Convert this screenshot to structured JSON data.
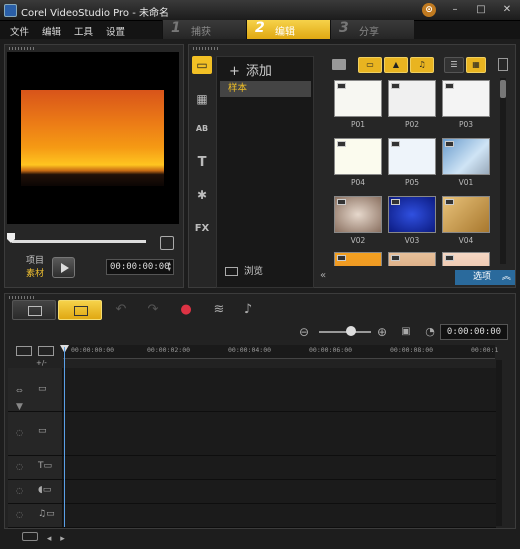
{
  "window": {
    "title": "Corel VideoStudio Pro - 未命名",
    "help_glyph": "⊙",
    "minimize_glyph": "–",
    "maximize_glyph": "□",
    "close_glyph": "✕"
  },
  "menu": [
    "文件",
    "编辑",
    "工具",
    "设置"
  ],
  "steps": [
    {
      "num": "1",
      "label": "捕获",
      "active": false
    },
    {
      "num": "2",
      "label": "编辑",
      "active": true
    },
    {
      "num": "3",
      "label": "分享",
      "active": false
    }
  ],
  "player": {
    "mode_project": "项目",
    "mode_clip": "素材",
    "timecode": "00:00:00:00"
  },
  "library": {
    "add_label": "添加",
    "selected_item": "样本",
    "browse_label": "浏览",
    "side_icons": [
      "video-icon",
      "instant-project-icon",
      "transition-icon",
      "title-icon",
      "graphic-icon",
      "filter-icon"
    ],
    "side_icon_glyphs": [
      "▭",
      "▦",
      "AB",
      "T",
      "✱",
      "FX"
    ],
    "thumbnails": [
      {
        "caption": "P01"
      },
      {
        "caption": "P02"
      },
      {
        "caption": "P03"
      },
      {
        "caption": "P04"
      },
      {
        "caption": "P05"
      },
      {
        "caption": "V01"
      },
      {
        "caption": "V02"
      },
      {
        "caption": "V03"
      },
      {
        "caption": "V04"
      },
      {
        "caption": ""
      },
      {
        "caption": ""
      },
      {
        "caption": ""
      }
    ],
    "options_label": "选项"
  },
  "timeline": {
    "timecode": "0:00:00:00",
    "ruler": [
      "00:00:00:00",
      "00:00:02:00",
      "00:00:04:00",
      "00:00:06:00",
      "00:00:08:00",
      "00:00:1"
    ],
    "add_label": "+/-"
  },
  "colors": {
    "accent": "#f2c025",
    "options": "#2a6a9c"
  }
}
